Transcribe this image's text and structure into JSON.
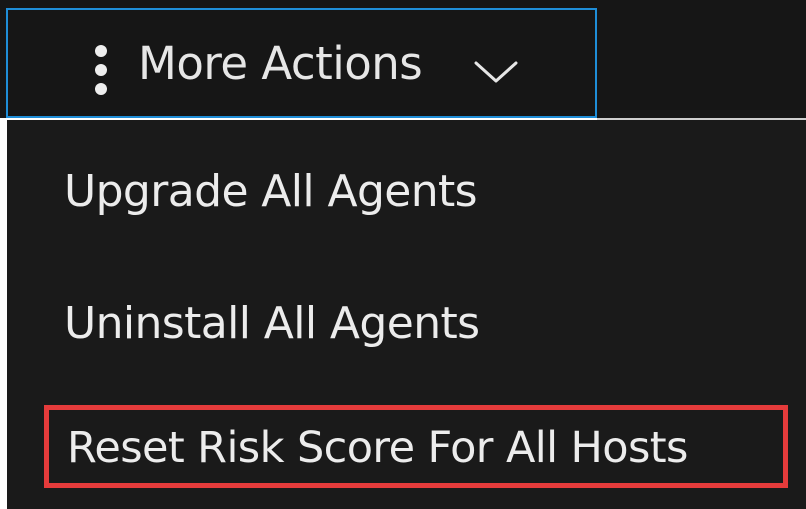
{
  "toolbar": {
    "more_actions_label": "More Actions"
  },
  "menu": {
    "items": [
      {
        "label": "Upgrade All Agents"
      },
      {
        "label": "Uninstall All Agents"
      },
      {
        "label": "Reset Risk Score For All Hosts"
      }
    ]
  },
  "icons": {
    "more": "kebab-vertical-icon",
    "dropdown": "chevron-down-icon"
  },
  "colors": {
    "background": "#161616",
    "focus_border": "#1f8ed8",
    "highlight": "#e53b3b",
    "text": "#e6e6e6"
  }
}
